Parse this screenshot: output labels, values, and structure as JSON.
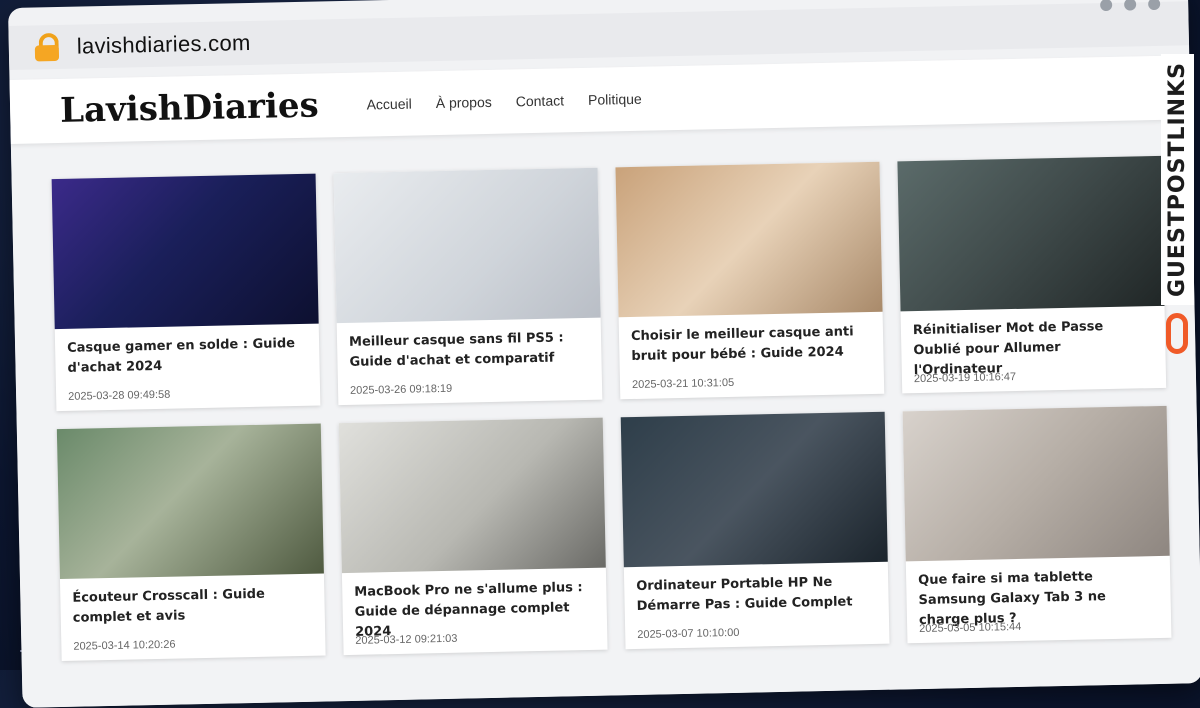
{
  "browser": {
    "url": "lavishdiaries.com"
  },
  "site": {
    "logo": "LavishDiaries",
    "nav": [
      "Accueil",
      "À propos",
      "Contact",
      "Politique"
    ]
  },
  "posts": [
    {
      "title": "Casque gamer en solde : Guide d'achat 2024",
      "date": "2025-03-28 09:49:58"
    },
    {
      "title": "Meilleur casque sans fil PS5 : Guide d'achat et comparatif",
      "date": "2025-03-26 09:18:19"
    },
    {
      "title": "Choisir le meilleur casque anti bruit pour bébé : Guide 2024",
      "date": "2025-03-21 10:31:05"
    },
    {
      "title": "Réinitialiser Mot de Passe Oublié pour Allumer l'Ordinateur",
      "date": "2025-03-19 10:16:47"
    },
    {
      "title": "Écouteur Crosscall : Guide complet et avis",
      "date": "2025-03-14 10:20:26"
    },
    {
      "title": "MacBook Pro ne s'allume plus : Guide de dépannage complet 2024",
      "date": "2025-03-12 09:21:03"
    },
    {
      "title": "Ordinateur Portable HP Ne Démarre Pas : Guide Complet",
      "date": "2025-03-07 10:10:00"
    },
    {
      "title": "Que faire si ma tablette Samsung Galaxy Tab 3 ne charge plus ?",
      "date": "2025-03-05 10:15:44"
    }
  ],
  "watermark": {
    "text": "GUESTPOSTLINKS"
  }
}
